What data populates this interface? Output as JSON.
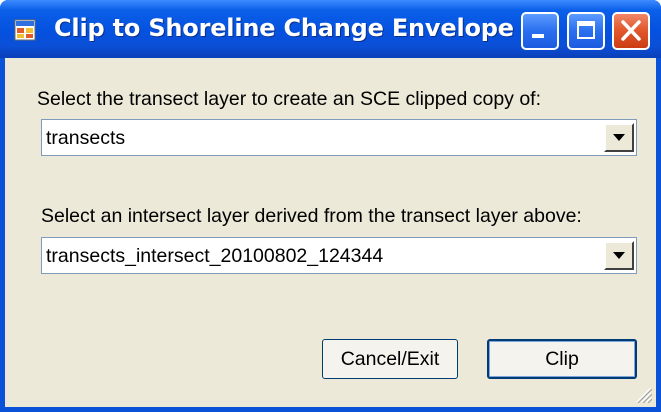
{
  "window": {
    "title": "Clip to Shoreline Change Envelope",
    "icon": "app-window-icon",
    "controls": {
      "minimize": "minimize-icon",
      "maximize": "maximize-icon",
      "close": "close-icon"
    }
  },
  "form": {
    "transect_label": "Select the transect layer to create an SCE clipped copy of:",
    "transect_value": "transects",
    "intersect_label": "Select an intersect layer derived from the transect layer above:",
    "intersect_value": "transects_intersect_20100802_124344"
  },
  "buttons": {
    "cancel": "Cancel/Exit",
    "clip": "Clip"
  },
  "colors": {
    "titlebar": "#0551df",
    "client_bg": "#ece9d8",
    "close_button": "#e25a2e",
    "combo_border": "#7f9db9"
  }
}
